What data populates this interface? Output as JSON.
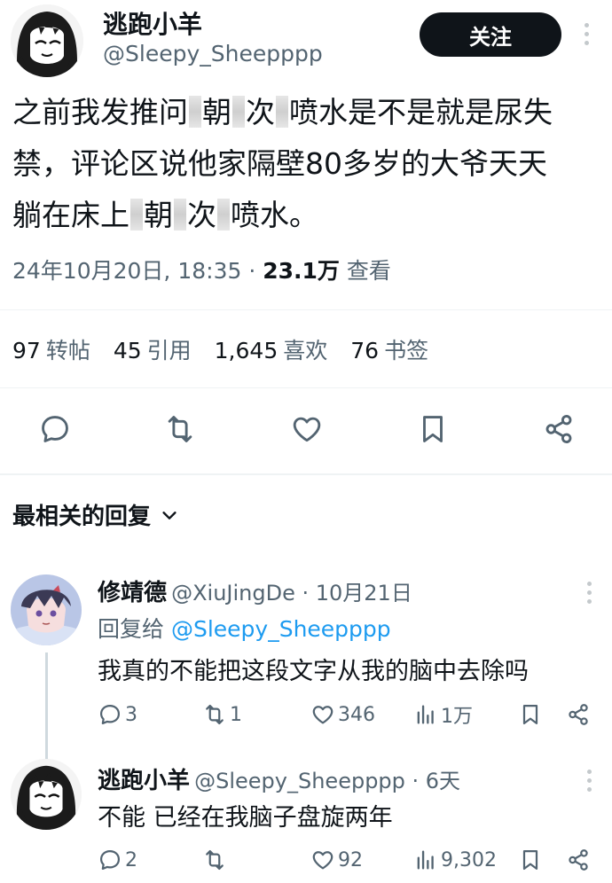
{
  "tweet": {
    "display_name": "逃跑小羊",
    "handle": "@Sleepy_Sheepppp",
    "follow_label": "关注",
    "text_lines": [
      [
        "之前我发推问",
        "朝",
        "次",
        "喷水是不是就是尿失"
      ],
      [
        "禁，评论区说他家隔壁80多岁的大爷天天"
      ],
      [
        "躺在床上",
        "朝",
        "次",
        "喷水。"
      ]
    ],
    "date_time": "24年10月20日, 18:35 · ",
    "views_count": "23.1万",
    "views_label": " 查看"
  },
  "stats": [
    {
      "count": "97",
      "label": "转帖"
    },
    {
      "count": "45",
      "label": "引用"
    },
    {
      "count": "1,645",
      "label": "喜欢"
    },
    {
      "count": "76",
      "label": "书签"
    }
  ],
  "sort": {
    "label": "最相关的回复"
  },
  "replies": [
    {
      "name": "修靖德",
      "handle_time": "@XiuJingDe · 10月21日",
      "reply_to_prefix": "回复给 ",
      "reply_to_mention": "@Sleepy_Sheepppp",
      "text": "我真的不能把这段文字从我的脑中去除吗",
      "reply_count": "3",
      "retweet_count": "1",
      "like_count": "346",
      "view_count": "1万"
    },
    {
      "name": "逃跑小羊",
      "handle_time": "@Sleepy_Sheepppp · 6天",
      "text": "不能 已经在我脑子盘旋两年",
      "reply_count": "2",
      "retweet_count": "",
      "like_count": "92",
      "view_count": "9,302"
    }
  ],
  "colors": {
    "text_primary": "#0f1419",
    "text_secondary": "#536471",
    "link": "#1d9bf0",
    "follow_bg": "#0f1419",
    "divider": "#eff3f4"
  },
  "icons": [
    "reply-icon",
    "retweet-icon",
    "like-icon",
    "bookmark-icon",
    "share-icon",
    "views-icon",
    "chevron-down-icon",
    "more-icon"
  ]
}
